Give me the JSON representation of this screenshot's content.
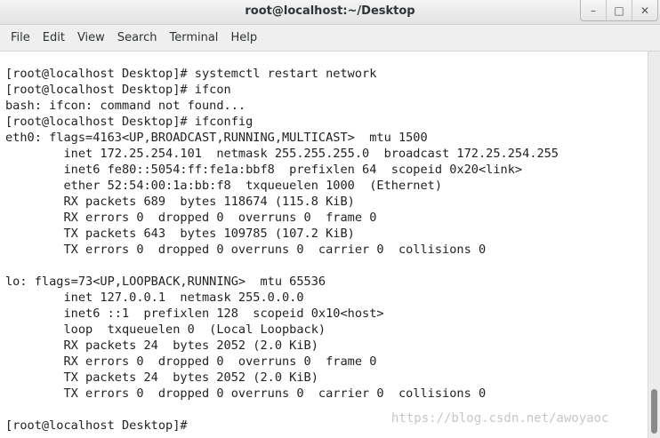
{
  "window": {
    "title": "root@localhost:~/Desktop",
    "controls": {
      "minimize": "–",
      "maximize": "□",
      "close": "✕"
    }
  },
  "menubar": {
    "items": [
      "File",
      "Edit",
      "View",
      "Search",
      "Terminal",
      "Help"
    ]
  },
  "terminal": {
    "lines": [
      "[root@localhost Desktop]# systemctl restart network",
      "[root@localhost Desktop]# ifcon",
      "bash: ifcon: command not found...",
      "[root@localhost Desktop]# ifconfig",
      "eth0: flags=4163<UP,BROADCAST,RUNNING,MULTICAST>  mtu 1500",
      "        inet 172.25.254.101  netmask 255.255.255.0  broadcast 172.25.254.255",
      "        inet6 fe80::5054:ff:fe1a:bbf8  prefixlen 64  scopeid 0x20<link>",
      "        ether 52:54:00:1a:bb:f8  txqueuelen 1000  (Ethernet)",
      "        RX packets 689  bytes 118674 (115.8 KiB)",
      "        RX errors 0  dropped 0  overruns 0  frame 0",
      "        TX packets 643  bytes 109785 (107.2 KiB)",
      "        TX errors 0  dropped 0 overruns 0  carrier 0  collisions 0",
      "",
      "lo: flags=73<UP,LOOPBACK,RUNNING>  mtu 65536",
      "        inet 127.0.0.1  netmask 255.0.0.0",
      "        inet6 ::1  prefixlen 128  scopeid 0x10<host>",
      "        loop  txqueuelen 0  (Local Loopback)",
      "        RX packets 24  bytes 2052 (2.0 KiB)",
      "        RX errors 0  dropped 0  overruns 0  frame 0",
      "        TX packets 24  bytes 2052 (2.0 KiB)",
      "        TX errors 0  dropped 0 overruns 0  carrier 0  collisions 0",
      "",
      "[root@localhost Desktop]#"
    ]
  },
  "watermark": "https://blog.csdn.net/awoyaoc",
  "colors": {
    "terminal_bg": "#ffffff",
    "terminal_fg": "#222222",
    "titlebar": "#e8e8e8"
  }
}
